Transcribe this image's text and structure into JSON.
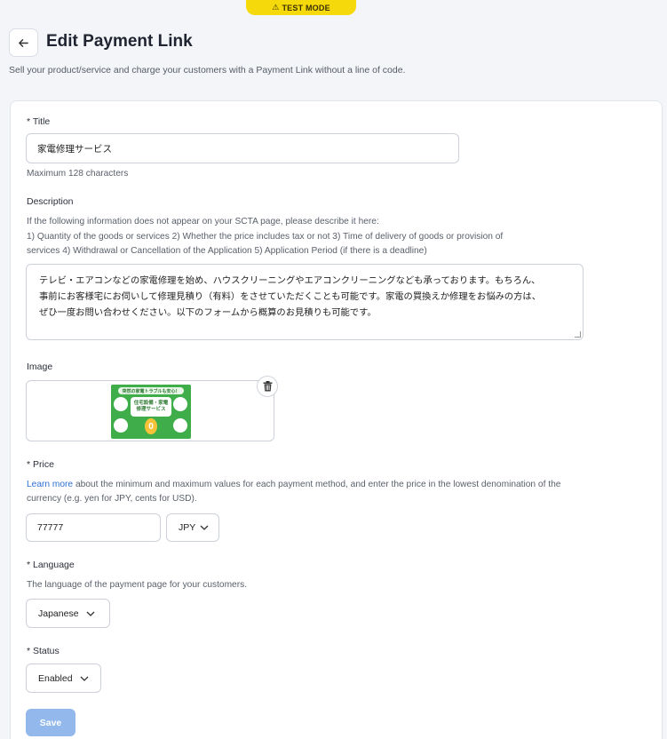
{
  "badge": {
    "label": "TEST MODE"
  },
  "header": {
    "back_icon": "arrow-left-icon",
    "title": "Edit Payment Link",
    "subtitle": "Sell your product/service and charge your customers with a Payment Link without a line of code."
  },
  "form": {
    "title": {
      "label": "* Title",
      "value": "家電修理サービス",
      "help": "Maximum 128 characters"
    },
    "description": {
      "label": "Description",
      "help_line1": "If the following information does not appear on your SCTA page, please describe it here:",
      "help_line2": "1) Quantity of the goods or services 2) Whether the price includes tax or not 3) Time of delivery of goods or provision of",
      "help_line3": "services 4) Withdrawal or Cancellation of the Application 5) Application Period (if there is a deadline)",
      "value_line1": "テレビ・エアコンなどの家電修理を始め、ハウスクリーニングやエアコンクリーニングなども承っております。もちろん、",
      "value_line2": "事前にお客様宅にお伺いして修理見積り（有料）をさせていただくことも可能です。家電の買換えか修理をお悩みの方は、",
      "value_line3": "ぜひ一度お問い合わせください。以下のフォームから概算のお見積りも可能です。"
    },
    "image": {
      "label": "Image",
      "thumb_banner": "突然の家電トラブルも安心！",
      "thumb_title1": "住宅設備・家電",
      "thumb_title2": "修理サービス",
      "thumb_price": "0",
      "delete_icon": "trash-icon"
    },
    "price": {
      "label": "* Price",
      "help_link": "Learn more",
      "help_rest1": " about the minimum and maximum values for each payment method, and enter the price in the lowest denomination of the",
      "help_line2": "currency (e.g. yen for JPY, cents for USD).",
      "value": "77777",
      "currency": "JPY"
    },
    "language": {
      "label": "* Language",
      "help": "The language of the payment page for your customers.",
      "value": "Japanese"
    },
    "status": {
      "label": "* Status",
      "value": "Enabled"
    },
    "save_label": "Save"
  }
}
